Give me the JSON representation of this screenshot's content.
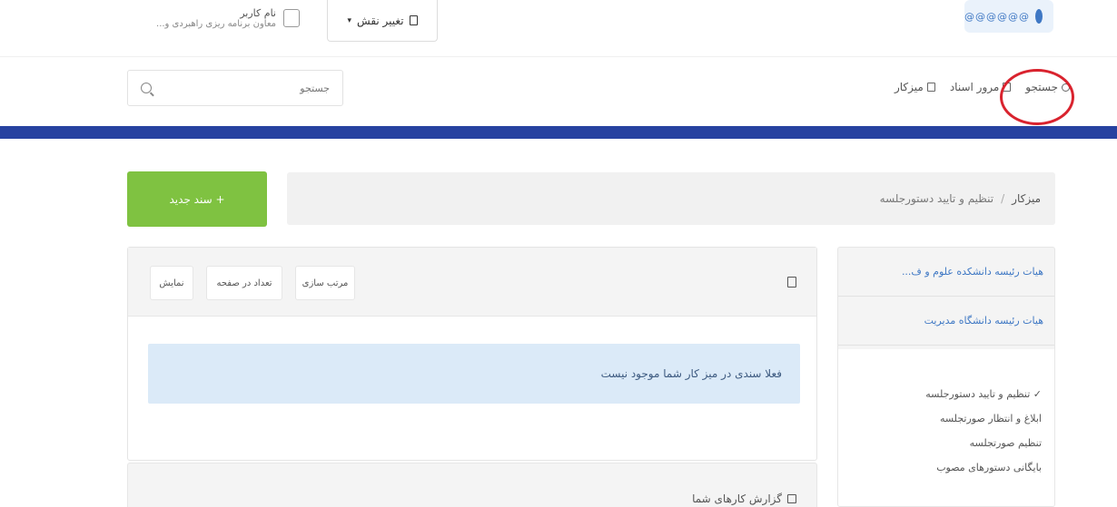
{
  "header": {
    "brand_text": "@@@@@@",
    "role_button": "تغییر نقش",
    "user_name": "نام کاربر",
    "user_desc": "معاون برنامه ریزی راهبردی و..."
  },
  "nav": {
    "items": [
      {
        "label": "میزکار"
      },
      {
        "label": "مرور اسناد"
      },
      {
        "label": "جستجو"
      }
    ],
    "search_placeholder": "جستجو"
  },
  "breadcrumb": {
    "home": "میزکار",
    "separator": "/",
    "current": "تنظیم و تایید دستورجلسه"
  },
  "new_document_button": "+ سند جدید",
  "sidebar": {
    "items": [
      {
        "label": "هیات رئیسه دانشکده علوم و ف..."
      },
      {
        "label": "هیات رئیسه دانشگاه مدیریت"
      }
    ],
    "sub_items": [
      {
        "label": "✓ تنظیم و تایید دستورجلسه"
      },
      {
        "label": "ابلاغ و انتظار صورتجلسه"
      },
      {
        "label": "تنظیم صورتجلسه"
      },
      {
        "label": "بایگانی دستورهای مصوب"
      }
    ]
  },
  "main_panel": {
    "pills": [
      {
        "label": "مرتب سازی"
      },
      {
        "label": "تعداد در صفحه"
      },
      {
        "label": "نمایش"
      }
    ],
    "empty_message": "فعلا سندی در میز کار شما موجود نیست"
  },
  "second_panel": {
    "title": "گزارش کارهای شما"
  },
  "colors": {
    "blue_bar": "#2742a0",
    "green_button": "#7fc241",
    "highlight": "#d9232e",
    "alert_bg": "#dbeaf8"
  }
}
